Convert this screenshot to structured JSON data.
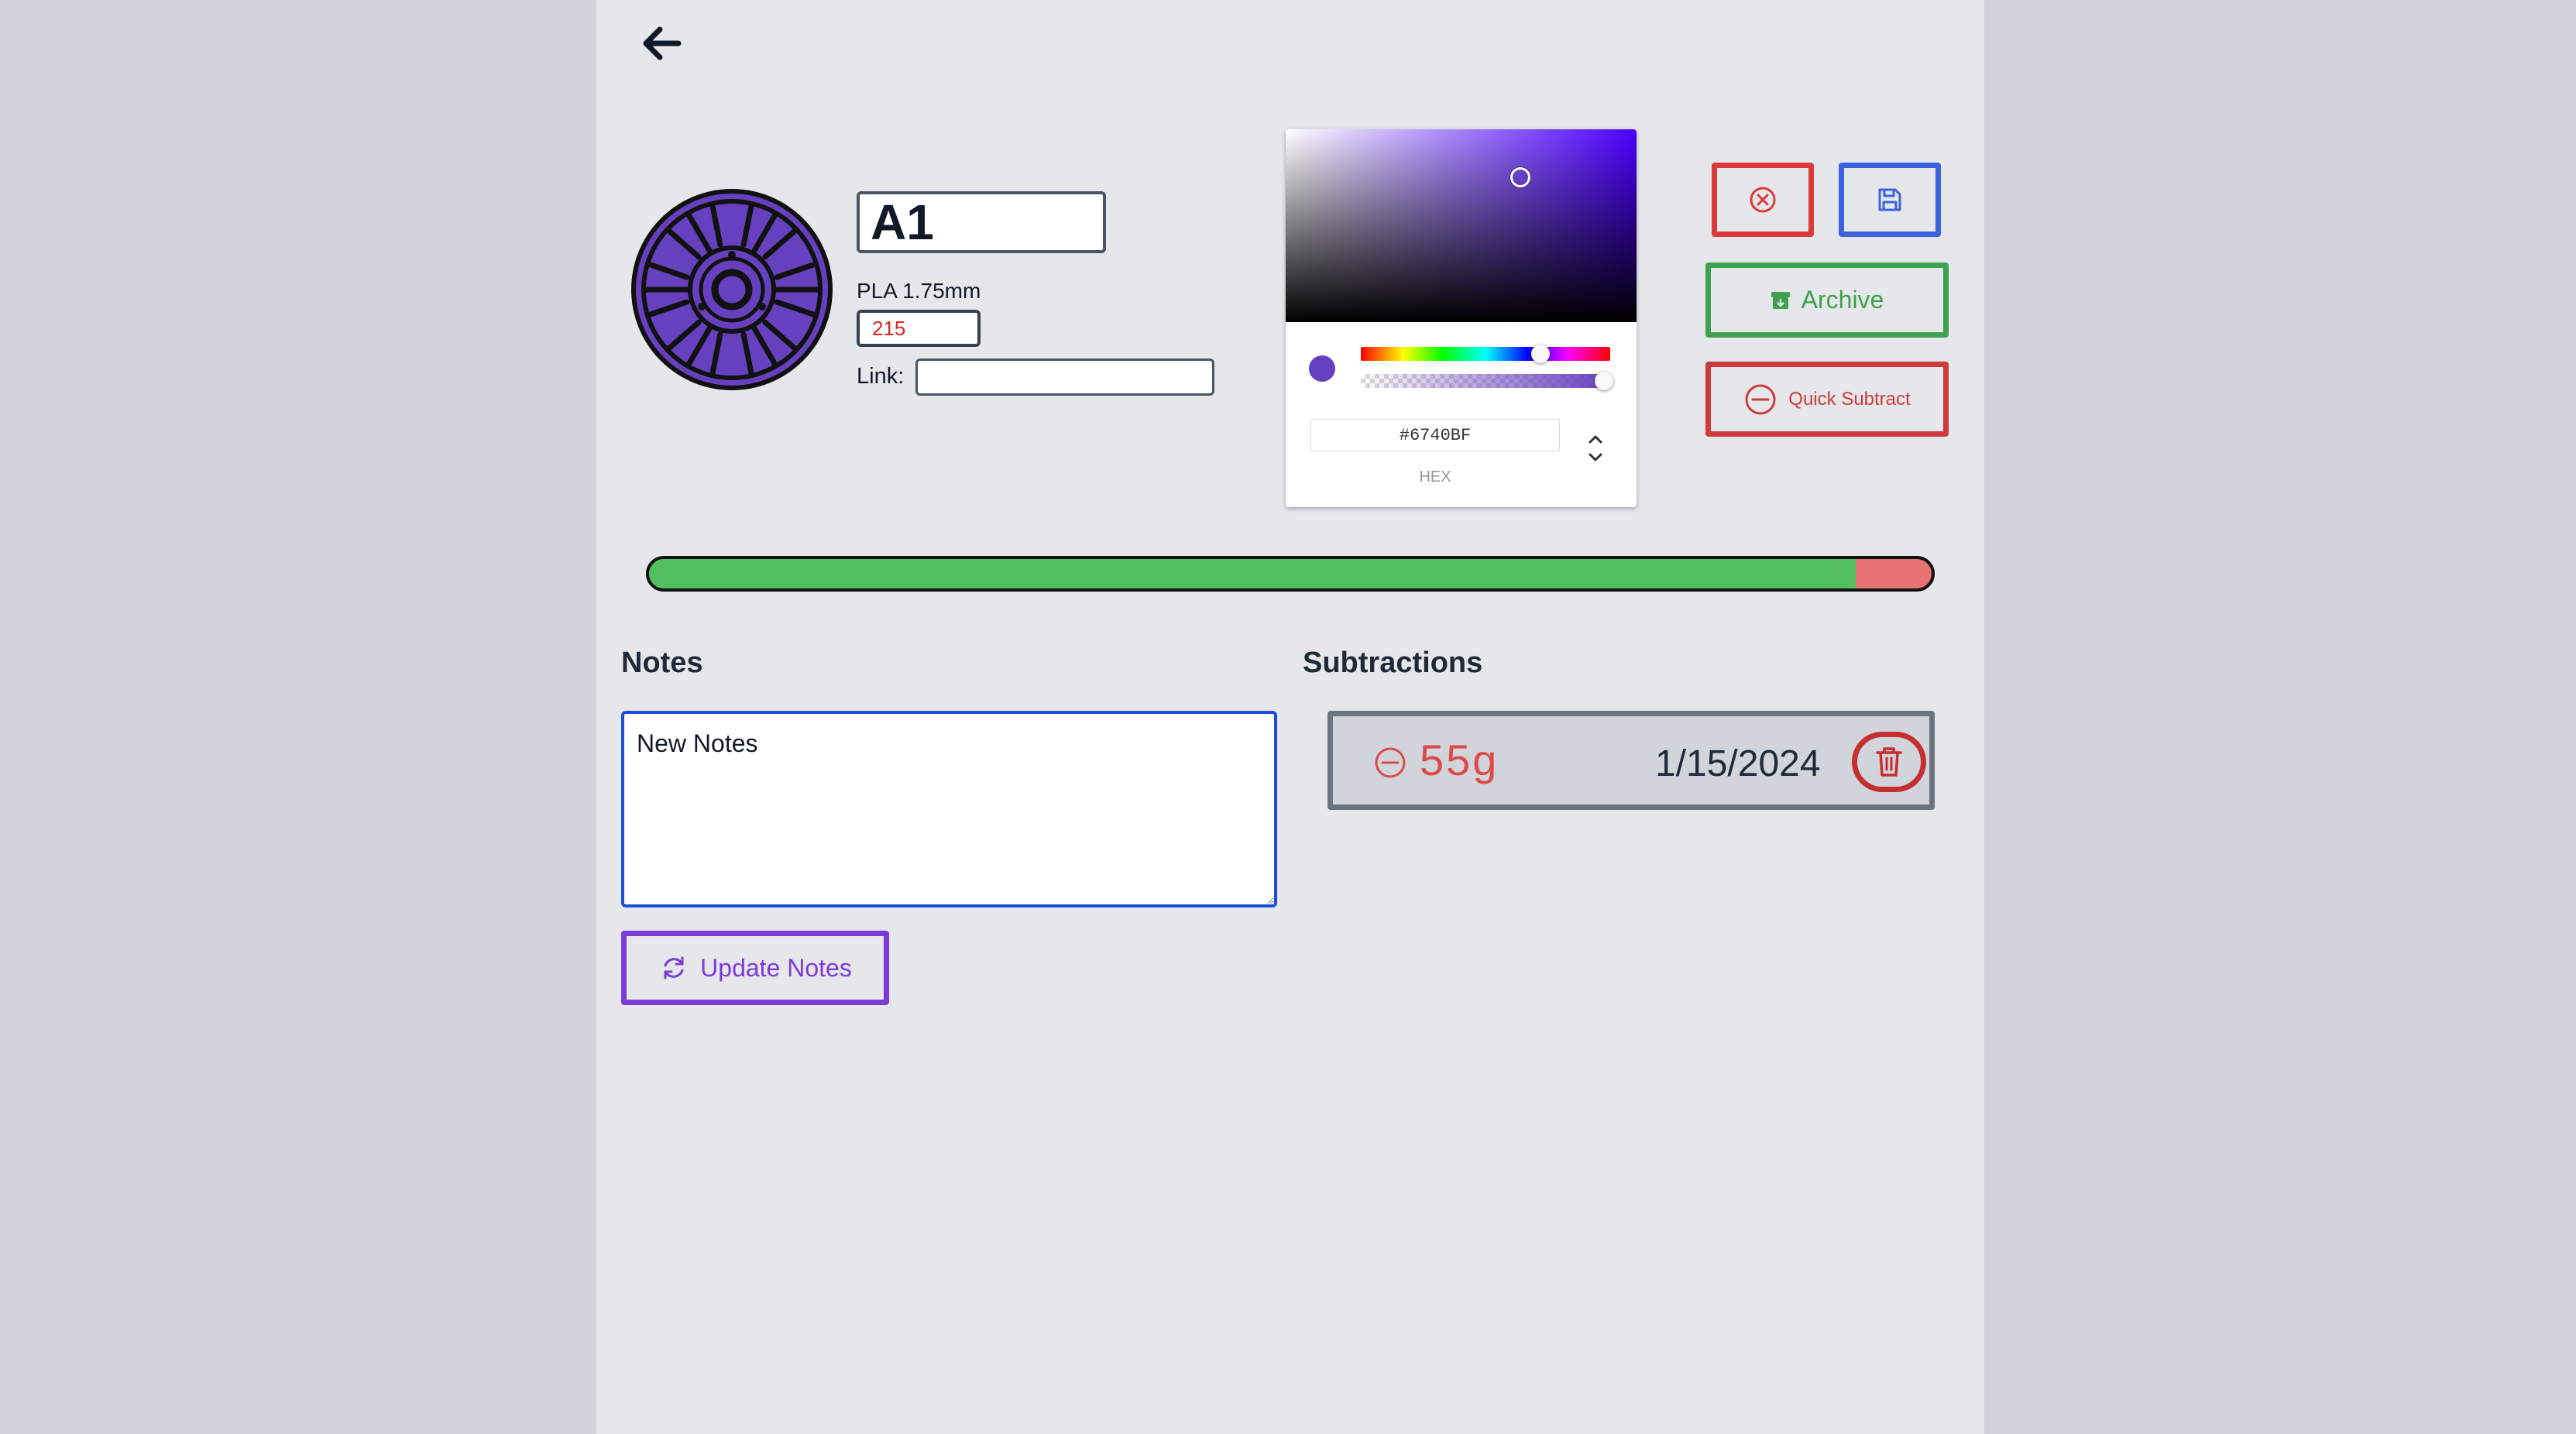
{
  "filament": {
    "name": "A1",
    "type_label": "PLA 1.75mm",
    "weight_value": "215",
    "link_label": "Link:",
    "link_value": ""
  },
  "color_picker": {
    "hex_value": "#6740BF",
    "format_label": "HEX",
    "hue_degrees": 258,
    "alpha": 1.0
  },
  "actions": {
    "archive_label": "Archive",
    "quick_subtract_label": "Quick Subtract"
  },
  "progress": {
    "remaining_fraction": 0.941,
    "used_fraction": 0.059
  },
  "notes": {
    "title": "Notes",
    "text": "New Notes",
    "update_label": "Update Notes"
  },
  "subtractions": {
    "title": "Subtractions",
    "items": [
      {
        "amount": "55g",
        "date": "1/15/2024"
      }
    ]
  },
  "colors": {
    "page_bg": "#d1d5db",
    "panel_bg": "#e5e7eb",
    "spool_color": "#6740BF",
    "progress_remaining": "#52c05f",
    "progress_used": "#e57373",
    "danger": "#dc3a3a",
    "primary": "#3b63dd",
    "success": "#3ea14d",
    "accent_purple": "#7c3ad9"
  }
}
